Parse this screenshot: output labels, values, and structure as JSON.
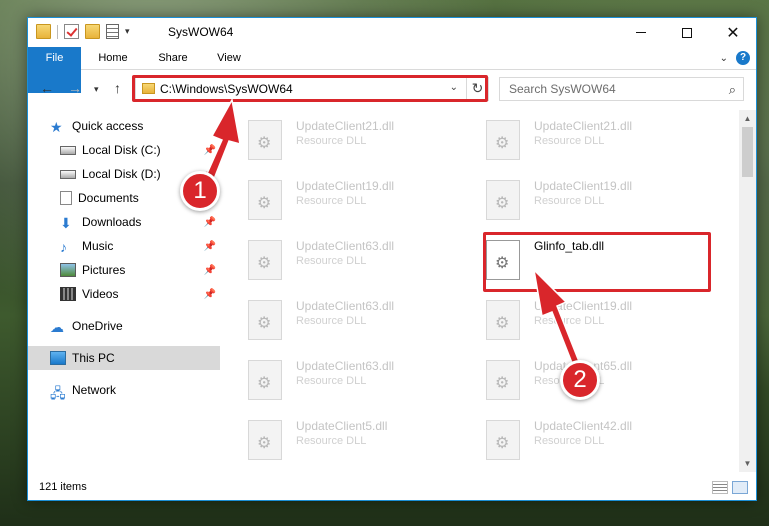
{
  "window": {
    "title": "SysWOW64"
  },
  "ribbon": {
    "tabs": [
      "File",
      "Home",
      "Share",
      "View"
    ],
    "help": "?"
  },
  "nav": {
    "address": "C:\\Windows\\SysWOW64",
    "search_placeholder": "Search SysWOW64"
  },
  "sidebar": {
    "items": [
      {
        "label": "Quick access"
      },
      {
        "label": "Local Disk (C:)"
      },
      {
        "label": "Local Disk (D:)"
      },
      {
        "label": "Documents"
      },
      {
        "label": "Downloads"
      },
      {
        "label": "Music"
      },
      {
        "label": "Pictures"
      },
      {
        "label": "Videos"
      },
      {
        "label": "OneDrive"
      },
      {
        "label": "This PC"
      },
      {
        "label": "Network"
      }
    ]
  },
  "files": [
    {
      "name": "UpdateClient21.dll",
      "type": "Resource DLL"
    },
    {
      "name": "UpdateClient21.dll",
      "type": "Resource DLL"
    },
    {
      "name": "UpdateClient19.dll",
      "type": "Resource DLL"
    },
    {
      "name": "UpdateClient19.dll",
      "type": "Resource DLL"
    },
    {
      "name": "UpdateClient63.dll",
      "type": "Resource DLL"
    },
    {
      "name": "Glinfo_tab.dll",
      "type": ""
    },
    {
      "name": "UpdateClient63.dll",
      "type": "Resource DLL"
    },
    {
      "name": "UpdateClient19.dll",
      "type": "Resource DLL"
    },
    {
      "name": "UpdateClient63.dll",
      "type": "Resource DLL"
    },
    {
      "name": "UpdateClient65.dll",
      "type": "Resource DLL"
    },
    {
      "name": "UpdateClient5.dll",
      "type": "Resource DLL"
    },
    {
      "name": "UpdateClient42.dll",
      "type": "Resource DLL"
    }
  ],
  "status": {
    "count": "121 items"
  },
  "annotations": {
    "step1": "1",
    "step2": "2",
    "highlight_color": "#d9262b"
  }
}
